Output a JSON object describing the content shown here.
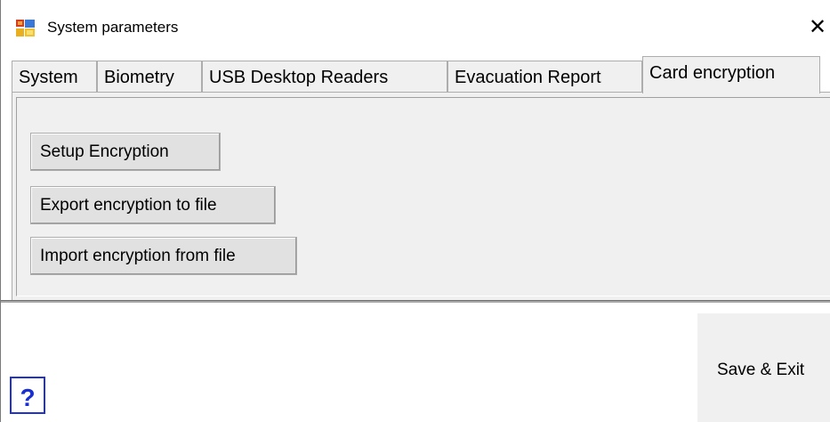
{
  "window": {
    "title": "System parameters",
    "close_glyph": "✕",
    "icon": "app-window-icon"
  },
  "tabs": [
    {
      "label": "System",
      "active": false
    },
    {
      "label": "Biometry",
      "active": false
    },
    {
      "label": "USB Desktop Readers",
      "active": false
    },
    {
      "label": "Evacuation Report",
      "active": false
    },
    {
      "label": "Card encryption",
      "active": true
    }
  ],
  "panel": {
    "buttons": [
      {
        "label": "Setup Encryption"
      },
      {
        "label": "Export encryption to file"
      },
      {
        "label": "Import encryption from file"
      }
    ]
  },
  "footer": {
    "save_exit_label": "Save & Exit",
    "help_label": "?"
  },
  "colors": {
    "panel_bg": "#f0f0f0",
    "button_bg": "#e1e1e1",
    "help_blue": "#1a2fd0"
  }
}
